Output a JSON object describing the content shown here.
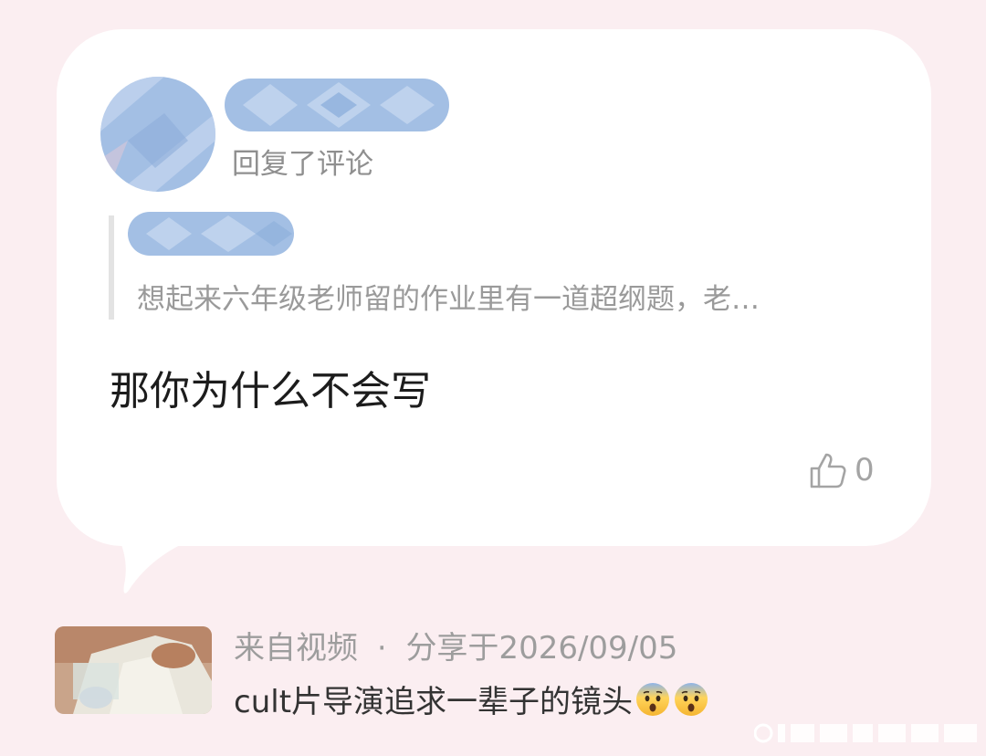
{
  "notification": {
    "action_text": "回复了评论",
    "quoted_comment": "想起来六年级老师留的作业里有一道超纲题，老…",
    "reply_text": "那你为什么不会写",
    "like_count": "0"
  },
  "source": {
    "origin_label": "来自视频",
    "separator": "·",
    "share_label": "分享于2026/09/05",
    "caption": "cult片导演追求一辈子的镜头"
  },
  "colors": {
    "page_background": "#fbeef1",
    "card_background": "#ffffff",
    "redaction_blue": "#9fbde3"
  },
  "icons": {
    "like": "thumbs-up-outline-icon",
    "emoji": "anxious-face-emoji"
  }
}
